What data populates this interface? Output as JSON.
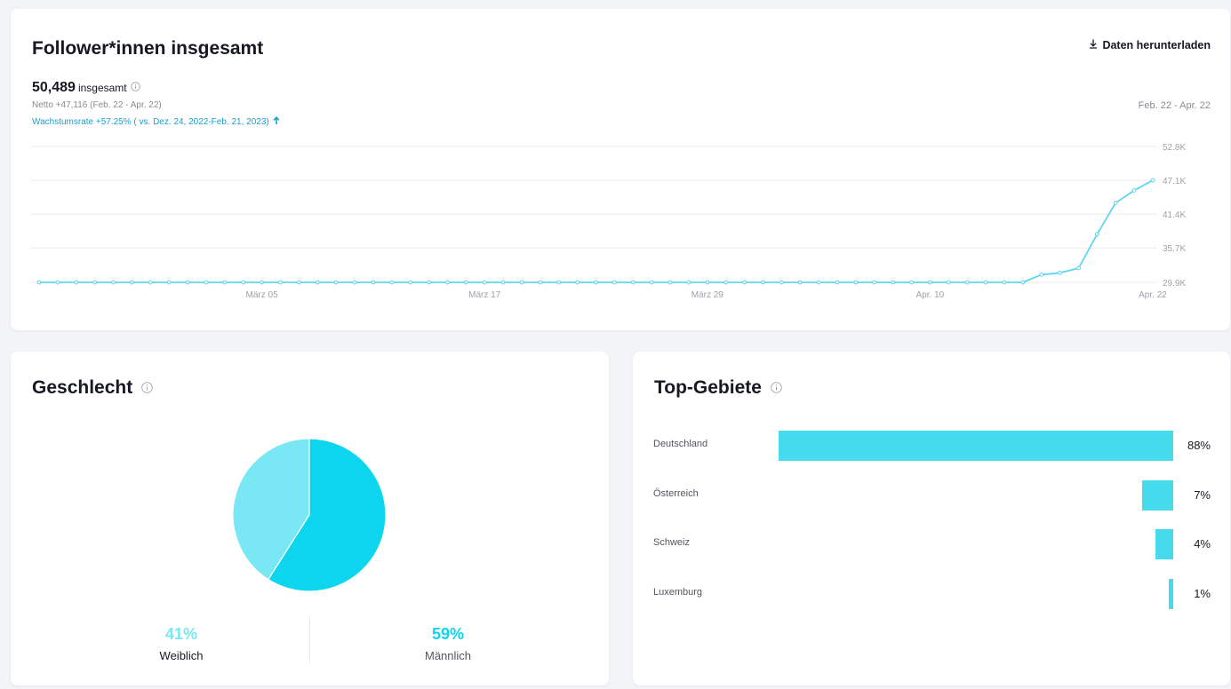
{
  "followers": {
    "title": "Follower*innen insgesamt",
    "download_label": "Daten herunterladen",
    "total_value": "50,489",
    "total_label": "insgesamt",
    "net_text": "Netto +47,116 (Feb. 22 - Apr. 22)",
    "growth_text": "Wachstumsrate +57.25% ( vs. Dez. 24, 2022-Feb. 21, 2023)",
    "date_range": "Feb. 22 - Apr. 22"
  },
  "gender": {
    "title": "Geschlecht",
    "female_pct": "41%",
    "female_label": "Weiblich",
    "male_pct": "59%",
    "male_label": "Männlich"
  },
  "regions": {
    "title": "Top-Gebiete",
    "items": [
      {
        "name": "Deutschland",
        "pct": "88%",
        "value": 88
      },
      {
        "name": "Österreich",
        "pct": "7%",
        "value": 7
      },
      {
        "name": "Schweiz",
        "pct": "4%",
        "value": 4
      },
      {
        "name": "Luxemburg",
        "pct": "1%",
        "value": 1
      }
    ]
  },
  "colors": {
    "line": "#5ed6ef",
    "female": "#79e7f4",
    "male": "#0dd5ee",
    "region_bar": "#45dbed",
    "growth_text": "#1a9fce"
  },
  "chart_data": [
    {
      "type": "line",
      "y_tick_labels": [
        "52.8K",
        "47.1K",
        "41.4K",
        "35.7K",
        "29.9K"
      ],
      "y_ticks": [
        52800,
        47100,
        41400,
        35700,
        29900
      ],
      "ylim": [
        29900,
        52800
      ],
      "x_tick_labels": [
        "März 05",
        "März 17",
        "März 29",
        "Apr. 10",
        "Apr. 22"
      ],
      "x_tick_index": [
        12,
        24,
        36,
        48,
        60
      ],
      "grid": true,
      "values": [
        29900,
        29900,
        29900,
        29900,
        29900,
        29900,
        29900,
        29900,
        29900,
        29900,
        29900,
        29900,
        29900,
        29900,
        29900,
        29900,
        29900,
        29900,
        29900,
        29900,
        29900,
        29900,
        29900,
        29900,
        29900,
        29900,
        29900,
        29900,
        29900,
        29900,
        29900,
        29900,
        29900,
        29900,
        29900,
        29900,
        29900,
        29900,
        29900,
        29900,
        29900,
        29900,
        29900,
        29900,
        29900,
        29900,
        29900,
        29900,
        29900,
        29900,
        29900,
        29900,
        29900,
        29900,
        31200,
        31500,
        32300,
        38000,
        43300,
        45400,
        47100
      ]
    },
    {
      "type": "pie",
      "labels": [
        "Weiblich",
        "Männlich"
      ],
      "values": [
        41,
        59
      ]
    },
    {
      "type": "bar",
      "categories": [
        "Deutschland",
        "Österreich",
        "Schweiz",
        "Luxemburg"
      ],
      "values": [
        88,
        7,
        4,
        1
      ]
    }
  ]
}
